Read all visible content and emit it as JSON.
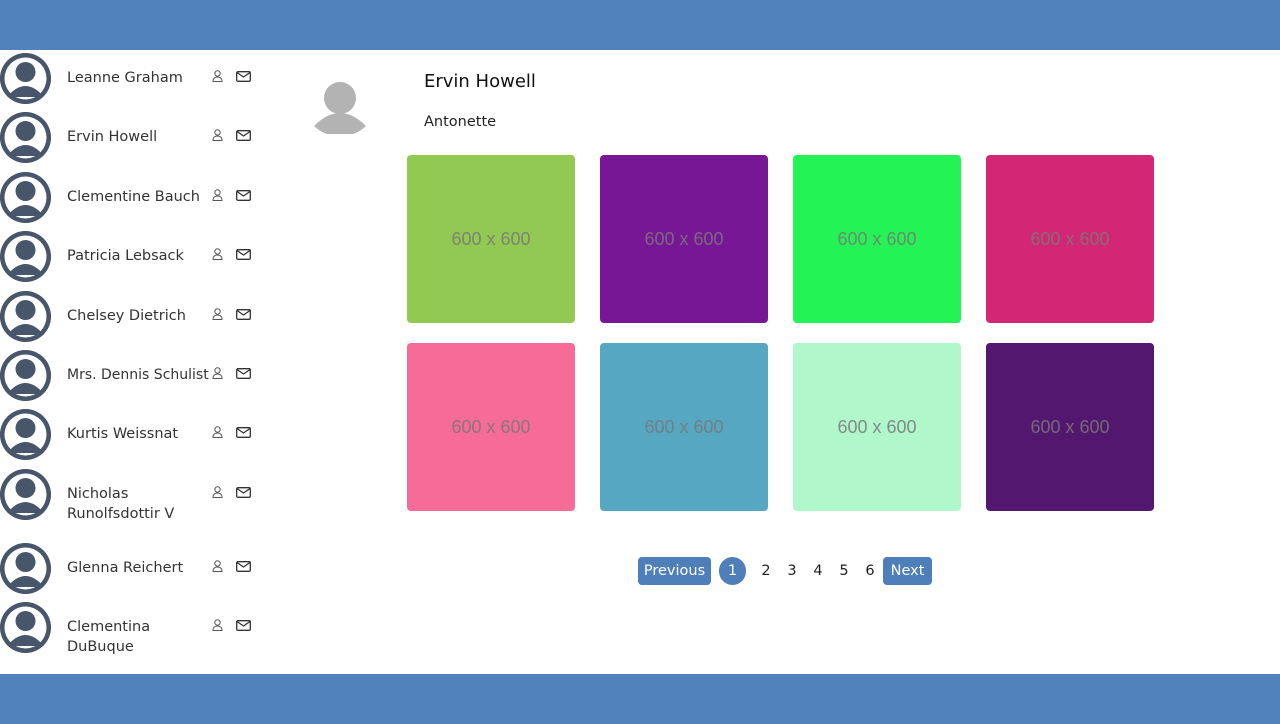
{
  "users": [
    {
      "name": "Leanne Graham"
    },
    {
      "name": "Ervin Howell"
    },
    {
      "name": "Clementine Bauch"
    },
    {
      "name": "Patricia Lebsack"
    },
    {
      "name": "Chelsey Dietrich"
    },
    {
      "name": "Mrs. Dennis Schulist"
    },
    {
      "name": "Kurtis Weissnat"
    },
    {
      "name": "Nicholas Runolfsdottir V"
    },
    {
      "name": "Glenna Reichert"
    },
    {
      "name": "Clementina DuBuque"
    }
  ],
  "user_icons": [
    "user-outline-icon",
    "mail-icon"
  ],
  "profile": {
    "name": "Ervin Howell",
    "username": "Antonette"
  },
  "photos": [
    {
      "label": "600 x 600",
      "color": "#92c952"
    },
    {
      "label": "600 x 600",
      "color": "#771796"
    },
    {
      "label": "600 x 600",
      "color": "#24f355"
    },
    {
      "label": "600 x 600",
      "color": "#d32776"
    },
    {
      "label": "600 x 600",
      "color": "#f66b97"
    },
    {
      "label": "600 x 600",
      "color": "#56a8c2"
    },
    {
      "label": "600 x 600",
      "color": "#b0f7cc"
    },
    {
      "label": "600 x 600",
      "color": "#54176f"
    }
  ],
  "pagination": {
    "previous": "Previous",
    "next": "Next",
    "active": "1",
    "pages": [
      "2",
      "3",
      "4",
      "5",
      "6"
    ]
  },
  "colors": {
    "header": "#5282bb",
    "avatar": "#48566c",
    "accent": "#4f7fba"
  }
}
